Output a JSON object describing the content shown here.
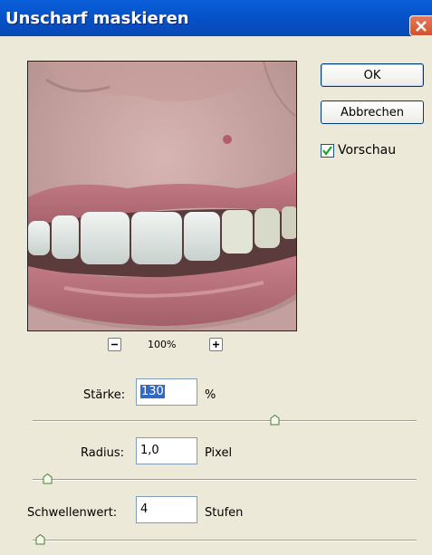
{
  "window": {
    "title": "Unscharf maskieren"
  },
  "buttons": {
    "ok": "OK",
    "cancel": "Abbrechen"
  },
  "preview_checkbox": {
    "label": "Vorschau",
    "checked": true
  },
  "zoom": {
    "level": "100%"
  },
  "params": [
    {
      "label": "Stärke:",
      "value": "130",
      "unit": "%",
      "slider_fraction": 0.63
    },
    {
      "label": "Radius:",
      "value": "1,0",
      "unit": "Pixel",
      "slider_fraction": 0.04
    },
    {
      "label": "Schwellenwert:",
      "value": "4",
      "unit": "Stufen",
      "slider_fraction": 0.02
    }
  ],
  "icons": {
    "close": "close-icon",
    "check": "checkmark-icon",
    "zoom_out": "minus-icon",
    "zoom_in": "plus-icon"
  }
}
